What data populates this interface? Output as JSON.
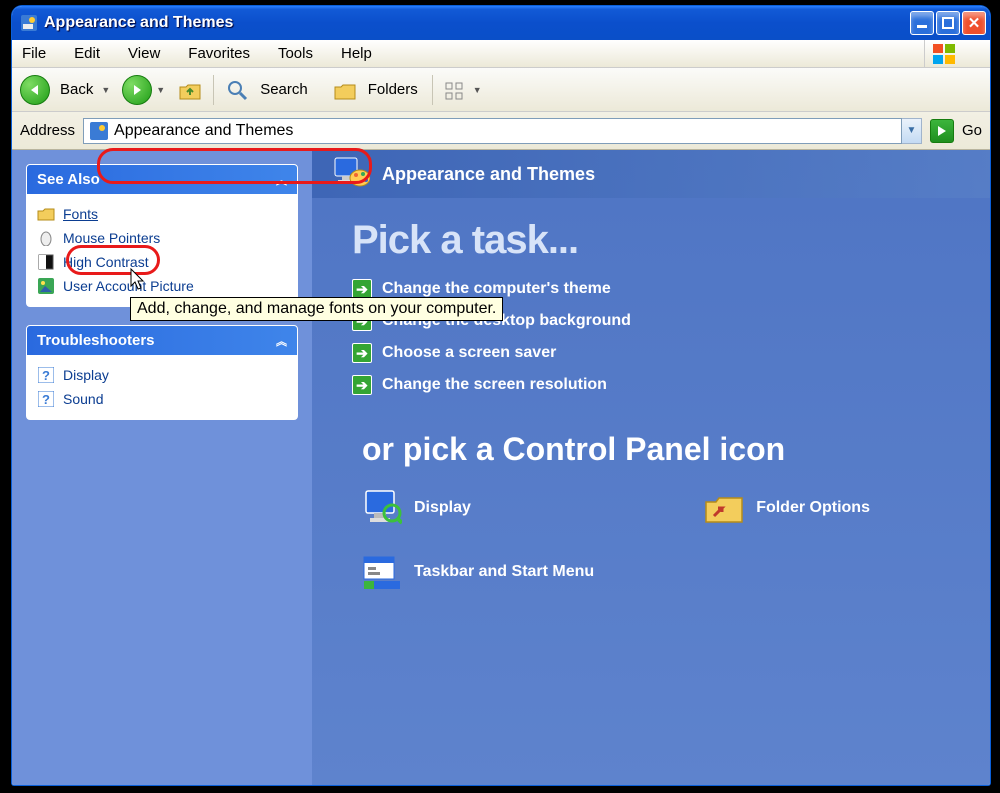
{
  "window": {
    "title": "Appearance and Themes"
  },
  "menu": {
    "file": "File",
    "edit": "Edit",
    "view": "View",
    "favorites": "Favorites",
    "tools": "Tools",
    "help": "Help"
  },
  "toolbar": {
    "back": "Back",
    "search": "Search",
    "folders": "Folders"
  },
  "address": {
    "label": "Address",
    "value": "Appearance and Themes",
    "go": "Go"
  },
  "sidebar": {
    "see_also": {
      "title": "See Also",
      "items": [
        {
          "label": "Fonts"
        },
        {
          "label": "Mouse Pointers"
        },
        {
          "label": "High Contrast"
        },
        {
          "label": "User Account Picture"
        }
      ]
    },
    "troubleshooters": {
      "title": "Troubleshooters",
      "items": [
        {
          "label": "Display"
        },
        {
          "label": "Sound"
        }
      ]
    }
  },
  "main": {
    "heading": "Appearance and Themes",
    "pick_task": "Pick a task...",
    "tasks": [
      "Change the computer's theme",
      "Change the desktop background",
      "Choose a screen saver",
      "Change the screen resolution"
    ],
    "or_pick": "or pick a Control Panel icon",
    "cp_icons": [
      "Display",
      "Folder Options",
      "Taskbar and Start Menu"
    ]
  },
  "tooltip": "Add, change, and manage fonts on your computer."
}
